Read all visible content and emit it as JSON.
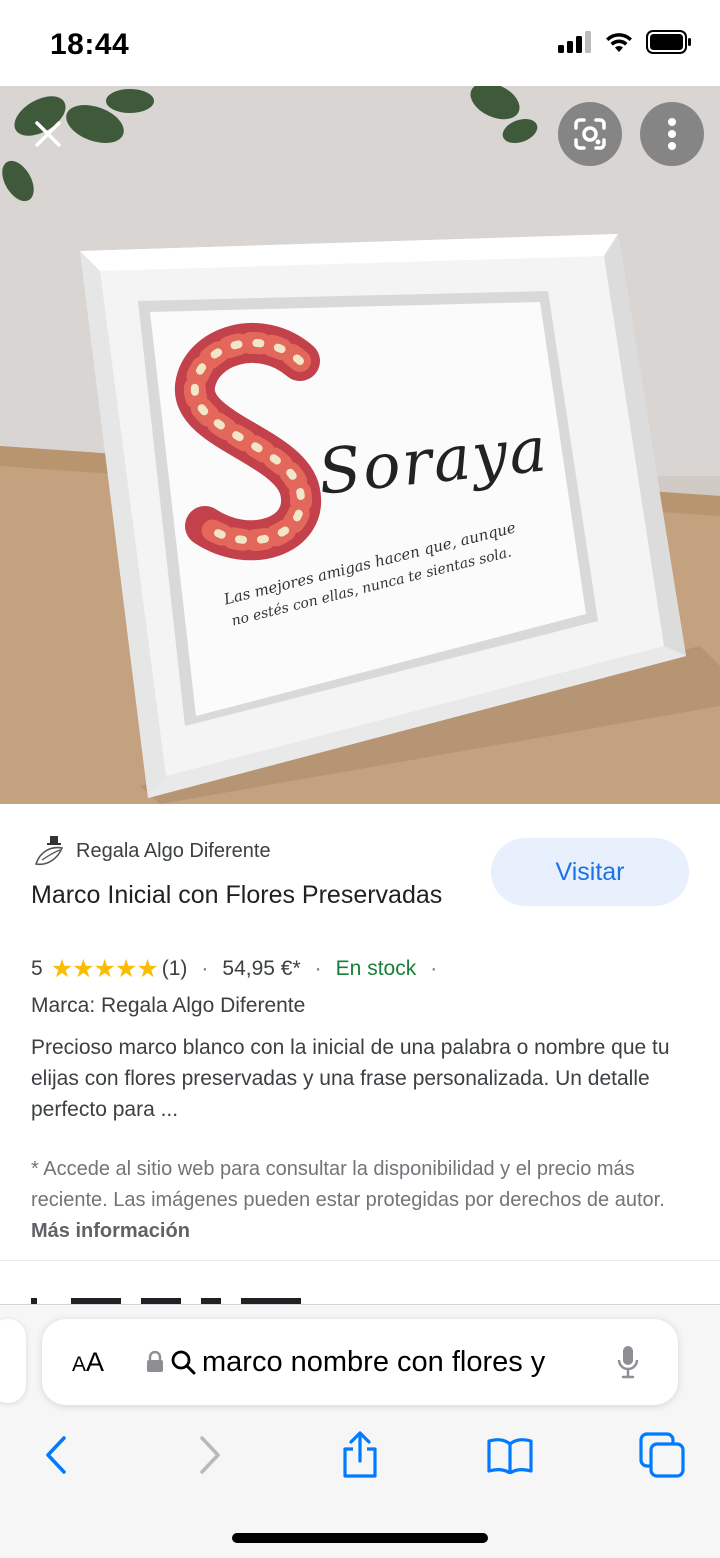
{
  "status_bar": {
    "time": "18:44"
  },
  "hero": {
    "script_name": "Soraya",
    "quote_line1": "Las mejores amigas hacen que, aunque",
    "quote_line2": "no estés con ellas, nunca te sientas sola."
  },
  "result": {
    "source": "Regala Algo Diferente",
    "visit_label": "Visitar",
    "title": "Marco Inicial con Flores Preservadas",
    "rating_value": "5",
    "stars": "★★★★★",
    "rating": 5,
    "review_count": "(1)",
    "price": "54,95 €*",
    "stock": "En stock",
    "brand": "Marca: Regala Algo Diferente",
    "description": "Precioso marco blanco con la inicial de una palabra o nombre que tu elijas con flores preservadas y una frase personalizada. Un detalle perfecto para ...",
    "disclaimer": "* Accede al sitio web para consultar la disponibilidad y el precio más reciente. Las imágenes pueden estar protegidas por derechos de autor.",
    "more_info": "Más información"
  },
  "browser": {
    "aa_label": "A",
    "aa_label_big": "A",
    "url": "marco nombre con flores y"
  },
  "colors": {
    "visit_bg": "#e8f0fe",
    "visit_text": "#1a73e8",
    "stock": "#188038",
    "stars": "#fbbc04",
    "ios_blue": "#007aff"
  }
}
